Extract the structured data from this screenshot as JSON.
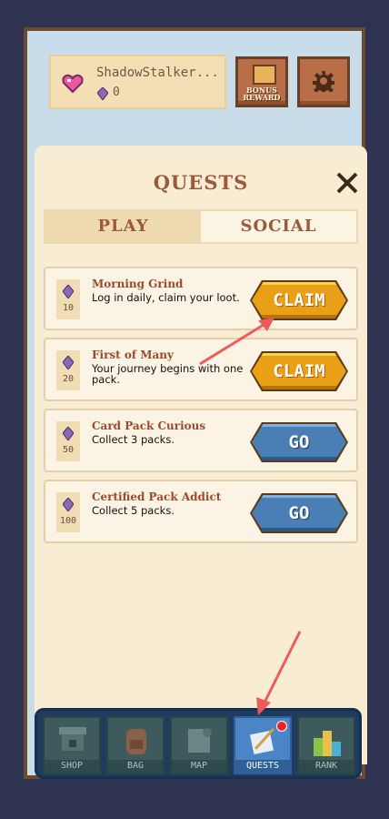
{
  "profile": {
    "name": "ShadowStalker...",
    "gems": "0"
  },
  "header": {
    "bonus_label_1": "BONUS",
    "bonus_label_2": "REWARD"
  },
  "panel": {
    "title": "QUESTS",
    "tabs": [
      "PLAY",
      "SOCIAL"
    ]
  },
  "quests": [
    {
      "title": "Morning Grind",
      "desc": "Log in daily, claim your loot.",
      "reward": "10",
      "action": "CLAIM"
    },
    {
      "title": "First of Many",
      "desc": "Your journey begins with one pack.",
      "reward": "20",
      "action": "CLAIM"
    },
    {
      "title": "Card Pack Curious",
      "desc": "Collect 3 packs.",
      "reward": "50",
      "action": "GO"
    },
    {
      "title": "Certified Pack Addict",
      "desc": "Collect 5 packs.",
      "reward": "100",
      "action": "GO"
    }
  ],
  "nav": [
    "SHOP",
    "BAG",
    "MAP",
    "QUESTS",
    "RANK"
  ],
  "colors": {
    "claim": "#e9a016",
    "go": "#4a7fb5",
    "accent_title": "#9a5a3c"
  }
}
